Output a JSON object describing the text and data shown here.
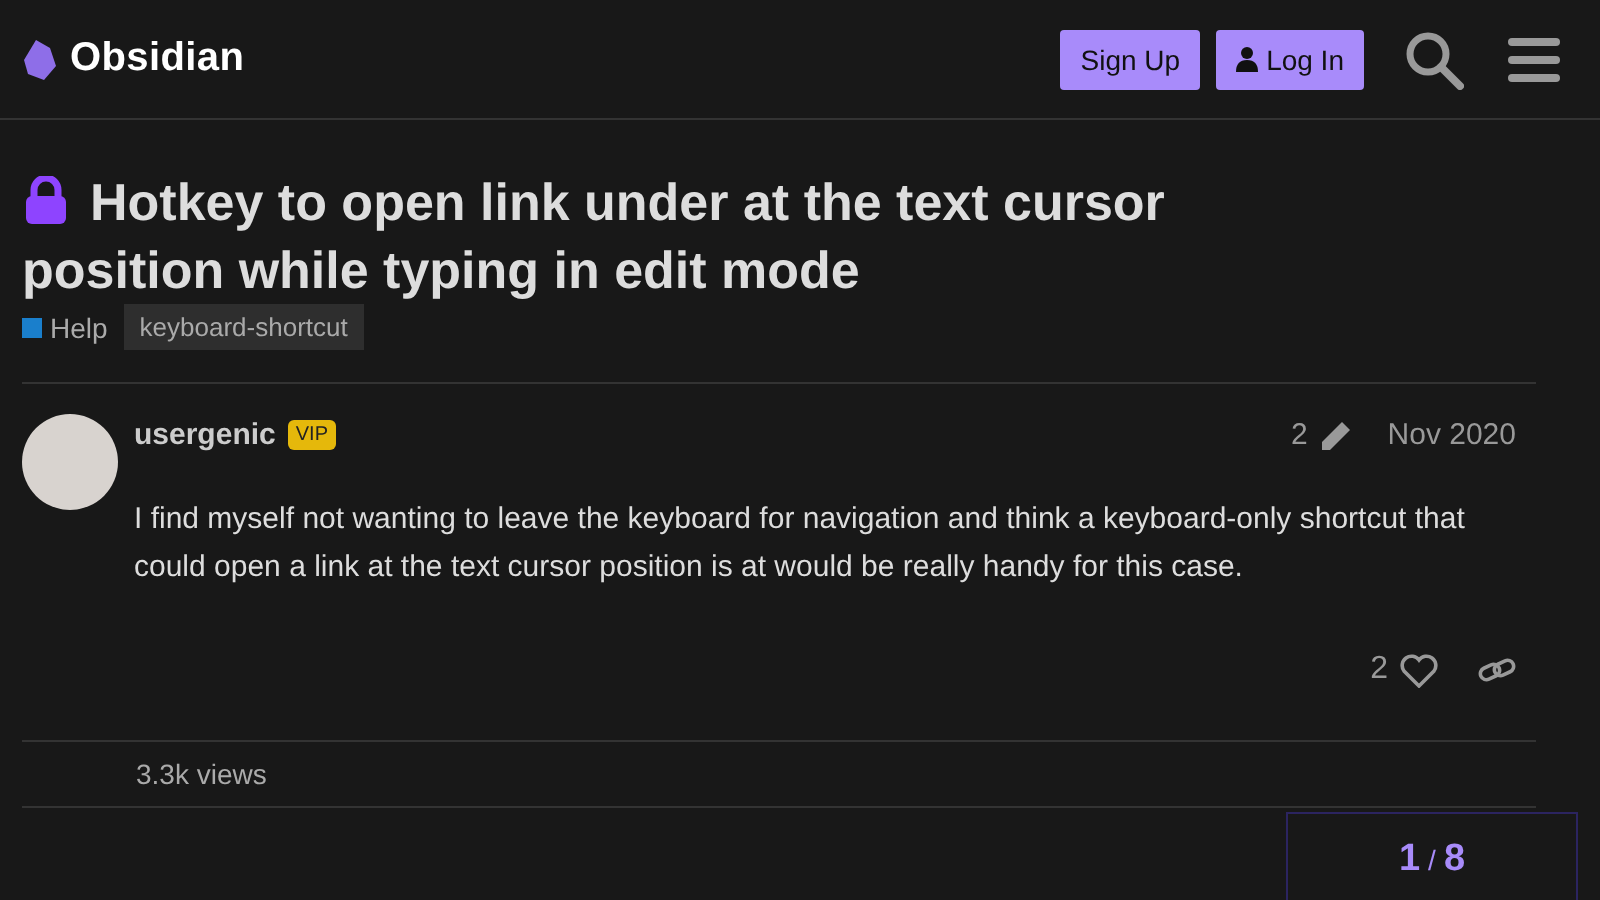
{
  "header": {
    "logo_text": "Obsidian",
    "buttons": [
      {
        "label": "Sign Up",
        "kind": "plain"
      },
      {
        "label": "Log In",
        "kind": "user"
      }
    ]
  },
  "topic": {
    "title": "Hotkey to open link under at the text cursor position while typing in edit mode",
    "locked": true,
    "category": {
      "name": "Help",
      "color": "#1a7fcc"
    },
    "tags": [
      "keyboard-shortcut"
    ]
  },
  "post": {
    "username": "usergenic",
    "badge": "VIP",
    "edits": "2",
    "date": "Nov 2020",
    "body": "I find myself not wanting to leave the keyboard for navigation and think a keyboard-only shortcut that could open a link at the text cursor position is at would be really handy for this case.",
    "likes": "2"
  },
  "views": "3.3k views",
  "progress": {
    "current": "1",
    "separator": "/",
    "total": "8"
  }
}
